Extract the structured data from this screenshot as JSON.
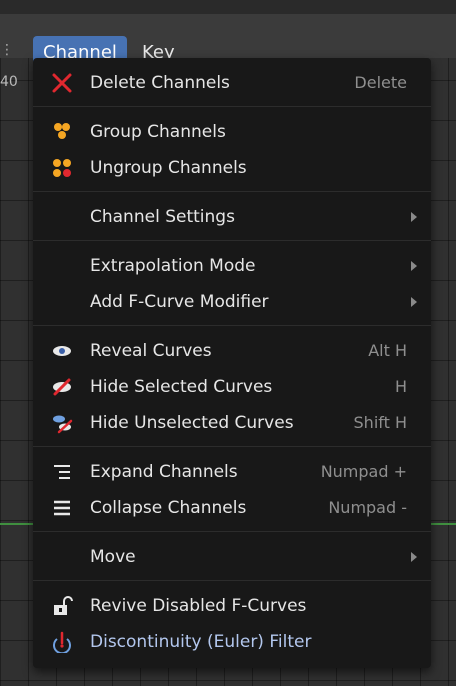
{
  "header": {
    "menus": [
      {
        "label": "Channel",
        "active": true
      },
      {
        "label": "Key",
        "active": false
      }
    ],
    "edge_text": "40"
  },
  "menu": {
    "items": [
      {
        "label": "Delete Channels",
        "shortcut": "Delete",
        "icon": "delete-x-icon"
      },
      {
        "label": "Group Channels",
        "icon": "group-icon"
      },
      {
        "label": "Ungroup Channels",
        "icon": "ungroup-icon"
      },
      {
        "label": "Channel Settings",
        "submenu": true
      },
      {
        "label": "Extrapolation Mode",
        "submenu": true
      },
      {
        "label": "Add F-Curve Modifier",
        "submenu": true
      },
      {
        "label": "Reveal Curves",
        "shortcut": "Alt H",
        "icon": "eye-icon"
      },
      {
        "label": "Hide Selected Curves",
        "shortcut": "H",
        "icon": "hide-eye-icon"
      },
      {
        "label": "Hide Unselected Curves",
        "shortcut": "Shift H",
        "icon": "hide-unselected-icon"
      },
      {
        "label": "Expand Channels",
        "shortcut": "Numpad +",
        "icon": "expand-lines-icon"
      },
      {
        "label": "Collapse Channels",
        "shortcut": "Numpad -",
        "icon": "collapse-lines-icon"
      },
      {
        "label": "Move",
        "submenu": true
      },
      {
        "label": "Revive Disabled F-Curves",
        "icon": "unlock-icon"
      },
      {
        "label": "Discontinuity (Euler) Filter",
        "icon": "euler-filter-icon"
      }
    ]
  },
  "colors": {
    "accent": "#4772b3",
    "menu_bg": "#181818",
    "shortcut": "#8f8f8f",
    "delete_red": "#e0282f",
    "group_orange": "#f5a623"
  }
}
